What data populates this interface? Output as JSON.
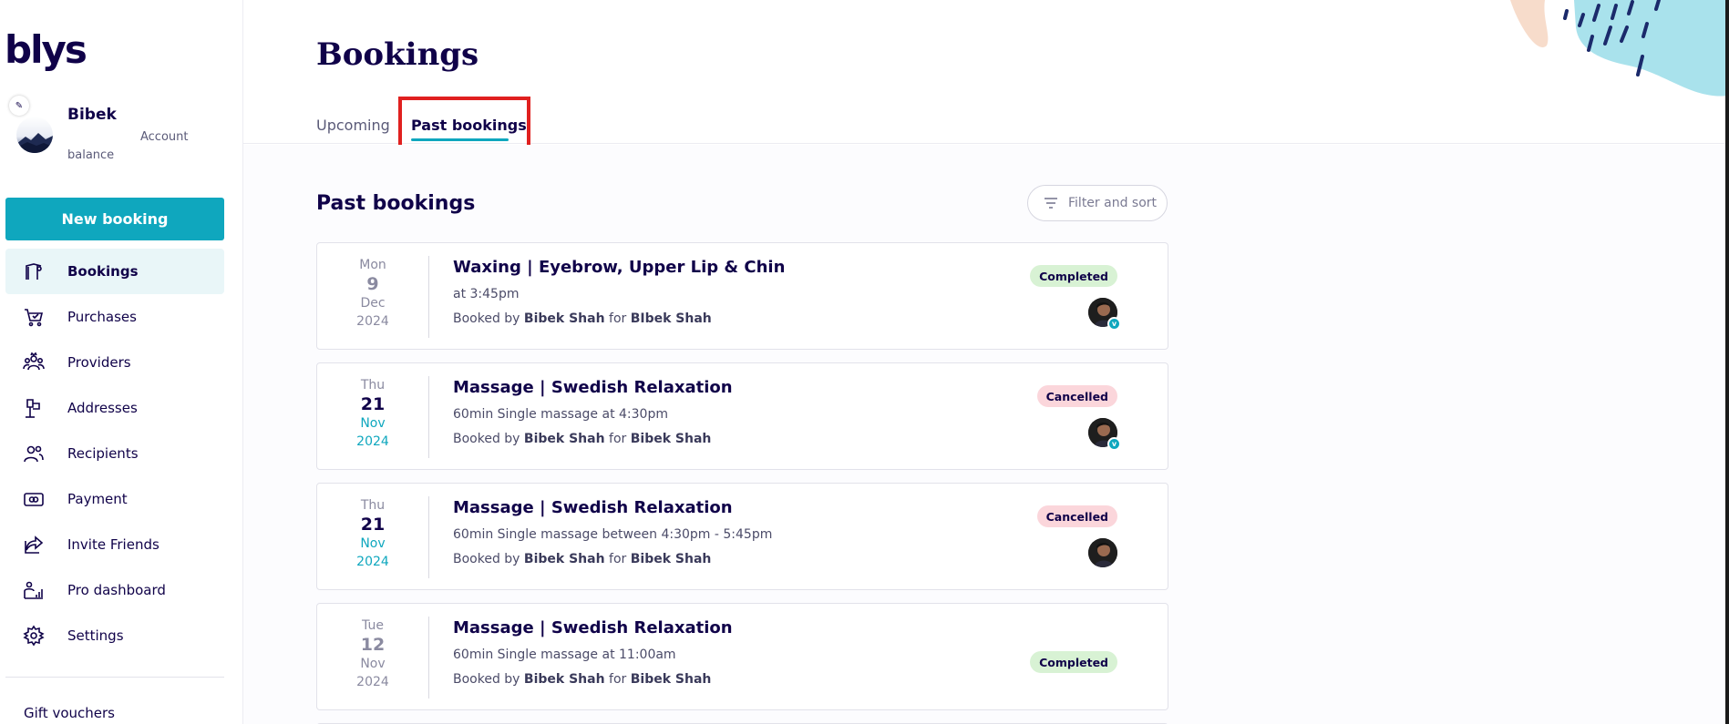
{
  "brand": {
    "logo": "blys"
  },
  "profile": {
    "name": "Bibek",
    "account_label": "Account",
    "balance_label": "balance"
  },
  "sidebar": {
    "new_booking": "New booking",
    "items": [
      {
        "label": "Bookings",
        "icon": "bookings-icon",
        "active": true
      },
      {
        "label": "Purchases",
        "icon": "cart-icon"
      },
      {
        "label": "Providers",
        "icon": "providers-icon"
      },
      {
        "label": "Addresses",
        "icon": "mailbox-icon"
      },
      {
        "label": "Recipients",
        "icon": "recipients-icon"
      },
      {
        "label": "Payment",
        "icon": "payment-icon"
      },
      {
        "label": "Invite Friends",
        "icon": "share-icon"
      },
      {
        "label": "Pro dashboard",
        "icon": "pro-dashboard-icon"
      },
      {
        "label": "Settings",
        "icon": "gear-icon"
      }
    ],
    "gift_vouchers": "Gift vouchers"
  },
  "header": {
    "title": "Bookings",
    "tabs": [
      {
        "label": "Upcoming",
        "active": false
      },
      {
        "label": "Past bookings",
        "active": true
      }
    ]
  },
  "main": {
    "section_title": "Past bookings",
    "filter_label": "Filter and sort",
    "bookings": [
      {
        "dow": "Mon",
        "day": "9",
        "month": "Dec",
        "year": "2024",
        "title": "Waxing | Eyebrow, Upper Lip & Chin",
        "detail": "at 3:45pm",
        "booked_by_prefix": "Booked by",
        "booked_by": "Bibek Shah",
        "for_word": "for",
        "booked_for": "BIbek Shah",
        "status": "Completed",
        "status_type": "completed",
        "verified": true
      },
      {
        "dow": "Thu",
        "day": "21",
        "month": "Nov",
        "year": "2024",
        "title": "Massage | Swedish Relaxation",
        "detail": "60min Single massage at 4:30pm",
        "booked_by_prefix": "Booked by",
        "booked_by": "Bibek Shah",
        "for_word": "for",
        "booked_for": "Bibek Shah",
        "status": "Cancelled",
        "status_type": "cancelled",
        "verified": true
      },
      {
        "dow": "Thu",
        "day": "21",
        "month": "Nov",
        "year": "2024",
        "title": "Massage | Swedish Relaxation",
        "detail": "60min Single massage between 4:30pm - 5:45pm",
        "booked_by_prefix": "Booked by",
        "booked_by": "Bibek Shah",
        "for_word": "for",
        "booked_for": "Bibek Shah",
        "status": "Cancelled",
        "status_type": "cancelled",
        "verified": false
      },
      {
        "dow": "Tue",
        "day": "12",
        "month": "Nov",
        "year": "2024",
        "title": "Massage | Swedish Relaxation",
        "detail": "60min Single massage at 11:00am",
        "booked_by_prefix": "Booked by",
        "booked_by": "Bibek Shah",
        "for_word": "for",
        "booked_for": "Bibek Shah",
        "status": "Completed",
        "status_type": "completed",
        "verified": null
      }
    ]
  },
  "colors": {
    "brand": "#0fa7be",
    "text": "#100249",
    "highlight": "#e0201f",
    "completed_bg": "#d8f2d4",
    "cancelled_bg": "#fbd6db"
  }
}
